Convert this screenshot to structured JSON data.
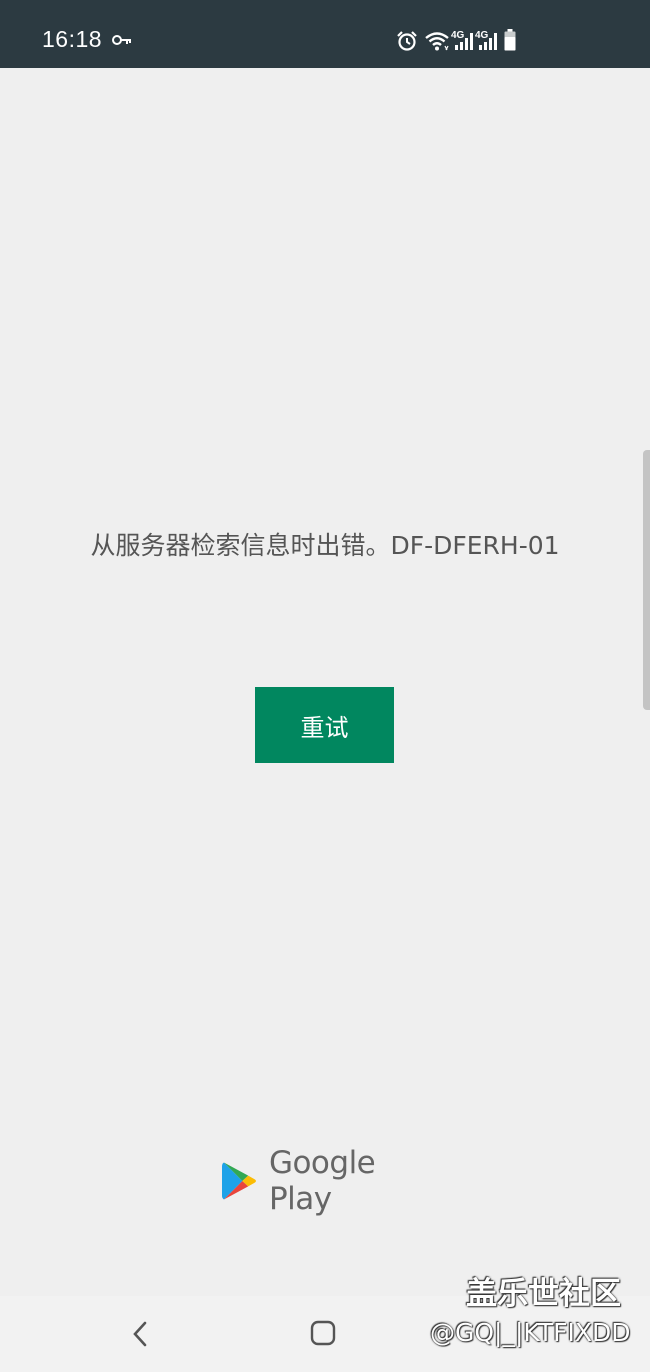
{
  "status_bar": {
    "time": "16:18",
    "icons": [
      "key-icon",
      "alarm-icon",
      "wifi-icon",
      "signal-4g-icon",
      "signal-4g-icon",
      "battery-icon"
    ],
    "network_label_1": "4G",
    "network_label_2": "4G"
  },
  "main": {
    "error_message": "从服务器检索信息时出错。DF-DFERH-01",
    "retry_label": "重试"
  },
  "footer": {
    "brand": "Google Play",
    "logo_icon": "google-play-icon"
  },
  "nav_bar": {
    "icons": [
      "back-icon",
      "home-icon"
    ]
  },
  "watermark": {
    "title": "盖乐世社区",
    "handle": "@GQ|_|KTFIXDD"
  },
  "colors": {
    "status_bar_bg": "#2c3a41",
    "page_bg": "#efefef",
    "accent": "#01875f",
    "error_text": "#555555"
  }
}
